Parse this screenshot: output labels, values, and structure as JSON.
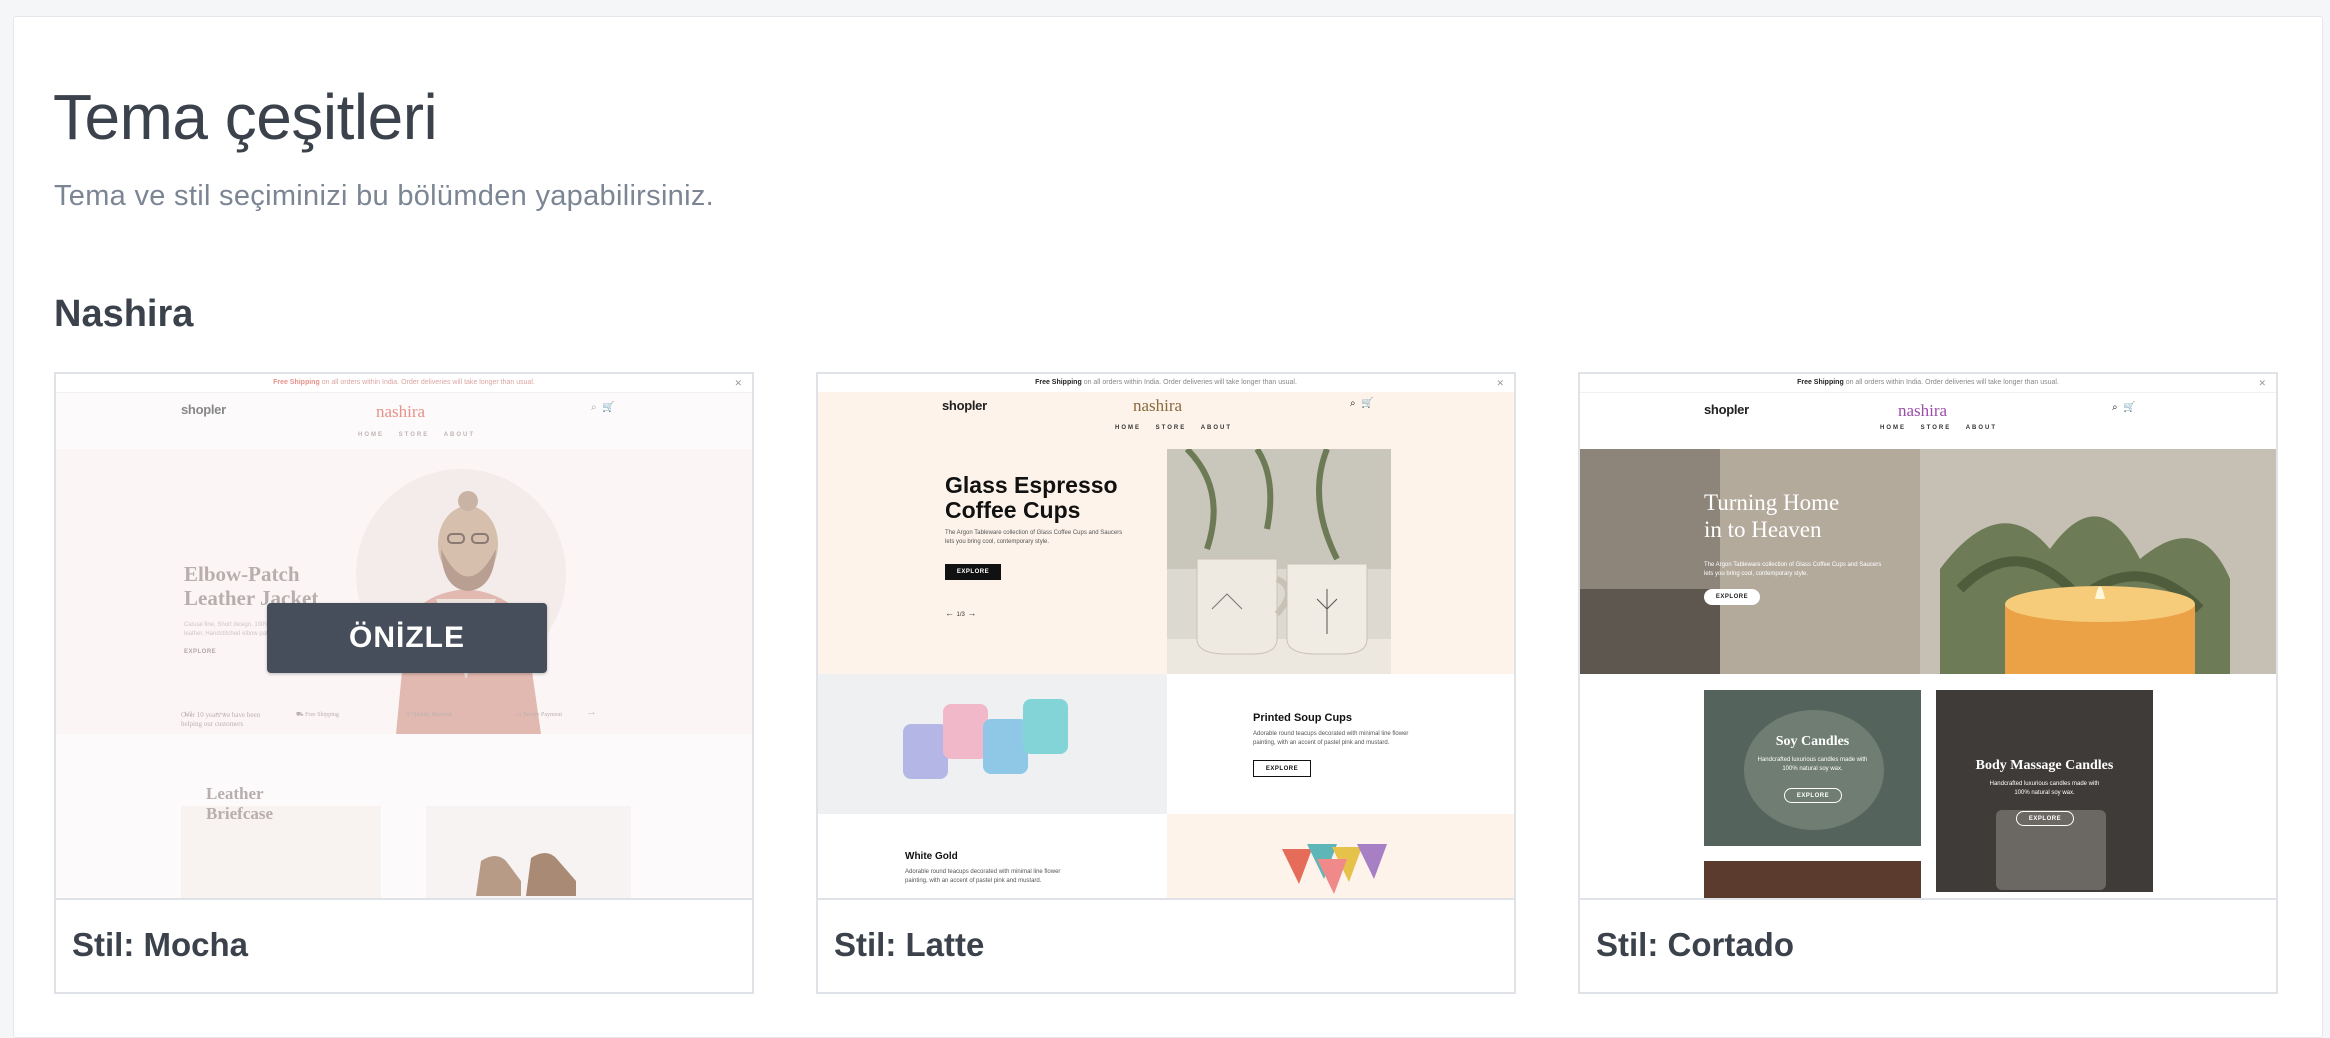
{
  "header": {
    "title": "Tema çeşitleri",
    "subtitle": "Tema ve stil seçiminizi bu bölümden yapabilirsiniz."
  },
  "section": {
    "title": "Nashira"
  },
  "preview_button": {
    "label": "ÖNİZLE"
  },
  "cards": [
    {
      "label": "Stil: Mocha",
      "shop": {
        "announcement_pre": "Free Shipping",
        "announcement_post": "on all orders within India. Order deliveries will take longer than usual.",
        "logo": "shopler",
        "brand": "nashira",
        "nav": [
          "HOME",
          "STORE",
          "ABOUT"
        ],
        "hero_title_1": "Elbow-Patch",
        "hero_title_2": "Leather Jacket",
        "hero_text": "Casual fine, Short design, 100% cured leather, Handstitched elbow patch.",
        "explore": "EXPLORE",
        "slide_counter": "1/3",
        "features_intro": "Over 10 years we have been helping our customers",
        "features": [
          "Free Shipping",
          "Quality Material",
          "Secure Payment"
        ],
        "product_title_1": "Leather",
        "product_title_2": "Briefcase"
      }
    },
    {
      "label": "Stil: Latte",
      "shop": {
        "announcement_pre": "Free Shipping",
        "announcement_post": "on all orders within India. Order deliveries will take longer than usual.",
        "logo": "shopler",
        "brand": "nashira",
        "nav": [
          "HOME",
          "STORE",
          "ABOUT"
        ],
        "hero_title_1": "Glass Espresso",
        "hero_title_2": "Coffee Cups",
        "hero_text": "The Argon Tableware collection of Glass Coffee Cups and Saucers lets you bring cool, contemporary style.",
        "explore": "EXPLORE",
        "slide_counter": "1/3",
        "product_2_title": "Printed Soup Cups",
        "product_2_text": "Adorable round teacups decorated with minimal line flower painting, with an accent of pastel pink and mustard.",
        "product_3_title": "White Gold",
        "product_3_text": "Adorable round teacups decorated with minimal line flower painting, with an accent of pastel pink and mustard."
      }
    },
    {
      "label": "Stil: Cortado",
      "shop": {
        "announcement_pre": "Free Shipping",
        "announcement_post": "on all orders within India. Order deliveries will take longer than usual.",
        "logo": "shopler",
        "brand": "nashira",
        "nav": [
          "HOME",
          "STORE",
          "ABOUT"
        ],
        "hero_title_1": "Turning Home",
        "hero_title_2": "in to Heaven",
        "hero_text": "The Argon Tableware collection of Glass Coffee Cups and Saucers lets you bring cool, contemporary style.",
        "explore": "EXPLORE",
        "tile_1_title": "Soy Candles",
        "tile_1_text": "Handcrafted luxurious candles made with 100% natural soy wax.",
        "tile_2_title": "Body Massage Candles",
        "tile_2_text": "Handcrafted luxurious candles made with 100% natural soy wax."
      }
    }
  ],
  "colors": {
    "mocha_brand": "#e8918a",
    "latte_brand": "#8a6a3c",
    "cortado_brand": "#9b4fa8",
    "button_bg": "#474e5b"
  }
}
